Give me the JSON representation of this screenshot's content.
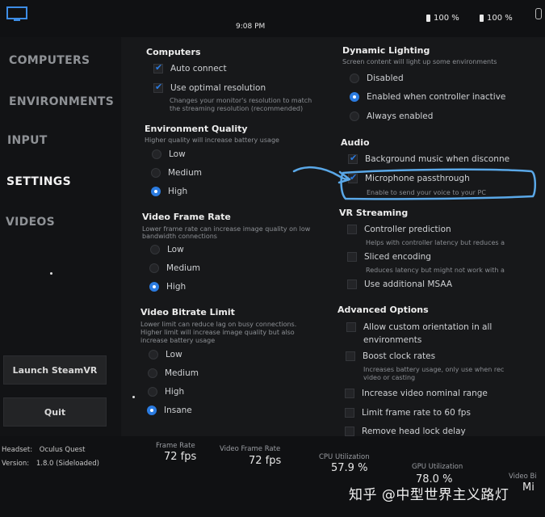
{
  "topbar": {
    "time": "9:08 PM",
    "battery_left": "100 %",
    "battery_right": "100 %"
  },
  "sidebar": {
    "items": [
      {
        "label": "COMPUTERS"
      },
      {
        "label": "ENVIRONMENTS"
      },
      {
        "label": "INPUT"
      },
      {
        "label": "SETTINGS"
      },
      {
        "label": "VIDEOS"
      }
    ],
    "active": "SETTINGS",
    "launch_label": "Launch SteamVR",
    "quit_label": "Quit"
  },
  "left_column": {
    "computers": {
      "title": "Computers",
      "auto_connect": "Auto connect",
      "optimal_resolution": "Use optimal resolution",
      "optimal_desc_1": "Changes your monitor's resolution to match",
      "optimal_desc_2": "the streaming resolution (recommended)"
    },
    "environment_quality": {
      "title": "Environment Quality",
      "desc": "Higher quality will increase battery usage",
      "options": [
        "Low",
        "Medium",
        "High"
      ],
      "selected": "High"
    },
    "video_frame_rate": {
      "title": "Video Frame Rate",
      "desc_1": "Lower frame rate can increase image quality on low",
      "desc_2": "bandwidth connections",
      "options": [
        "Low",
        "Medium",
        "High"
      ],
      "selected": "High"
    },
    "video_bitrate": {
      "title": "Video Bitrate Limit",
      "desc_1": "Lower limit can reduce lag on busy connections.",
      "desc_2": "Higher limit will increase image quality but also",
      "desc_3": "increase battery usage",
      "options": [
        "Low",
        "Medium",
        "High",
        "Insane"
      ],
      "selected": "Insane"
    }
  },
  "right_column": {
    "dynamic_lighting": {
      "title": "Dynamic Lighting",
      "desc": "Screen content will light up some environments",
      "options": [
        "Disabled",
        "Enabled when controller inactive",
        "Always enabled"
      ],
      "selected": "Enabled when controller inactive"
    },
    "audio": {
      "title": "Audio",
      "background_music": "Background music when disconne",
      "mic_passthrough": "Microphone passthrough",
      "mic_desc": "Enable to send your voice to your PC"
    },
    "vr_streaming": {
      "title": "VR Streaming",
      "controller_prediction": "Controller prediction",
      "controller_desc": "Helps with controller latency but reduces a",
      "sliced_encoding": "Sliced encoding",
      "sliced_desc": "Reduces latency but might not work with a",
      "msaa": "Use additional MSAA"
    },
    "advanced": {
      "title": "Advanced Options",
      "custom_orientation_1": "Allow custom orientation in all",
      "custom_orientation_2": "environments",
      "boost_clock": "Boost clock rates",
      "boost_desc_1": "Increases battery usage, only use when rec",
      "boost_desc_2": "video or casting",
      "increase_nominal": "Increase video nominal range",
      "limit_frame_rate": "Limit frame rate to 60 fps",
      "remove_head_lock": "Remove head lock delay"
    }
  },
  "statusbar": {
    "headset_label": "Headset:",
    "headset_value": "Oculus Quest",
    "version_label": "Version:",
    "version_value": "1.8.0 (Sideloaded)",
    "frame_rate_label": "Frame Rate",
    "frame_rate_value": "72 fps",
    "video_frame_rate_label": "Video Frame Rate",
    "video_frame_rate_value": "72 fps",
    "cpu_label": "CPU Utilization",
    "cpu_value": "57.9 %",
    "gpu_label": "GPU Utilization",
    "gpu_value": "78.0 %",
    "video_bitrate_label": "Video Bi",
    "video_bitrate_value": "Mi"
  },
  "watermark": "知乎 @中型世界主义路灯",
  "colors": {
    "accent": "#2b7be0",
    "annotation": "#5aa8e8",
    "background": "#17181a",
    "sidebar": "#121315"
  }
}
